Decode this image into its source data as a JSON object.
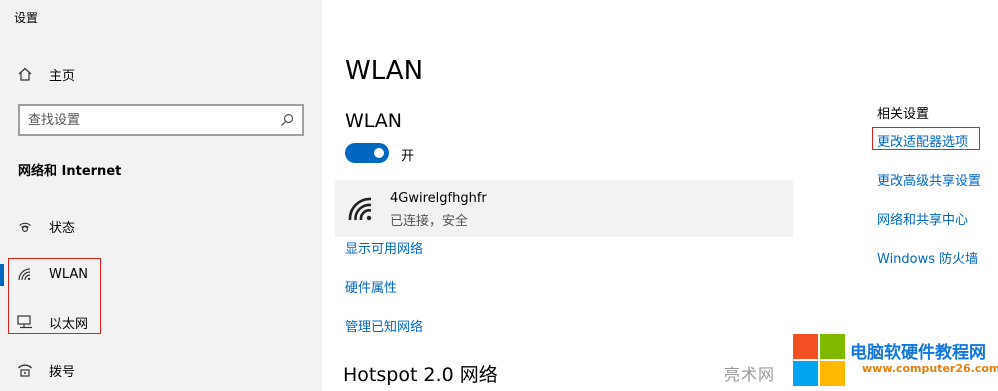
{
  "window": {
    "title": "设置"
  },
  "sidebar": {
    "home_label": "主页",
    "search_placeholder": "查找设置",
    "section_heading": "网络和 Internet",
    "items": [
      {
        "label": "状态",
        "icon": "status-icon"
      },
      {
        "label": "WLAN",
        "icon": "wifi-icon",
        "selected": true
      },
      {
        "label": "以太网",
        "icon": "ethernet-icon"
      },
      {
        "label": "拨号",
        "icon": "dialup-icon"
      }
    ]
  },
  "main": {
    "title": "WLAN",
    "section_title": "WLAN",
    "toggle": {
      "state_label": "开",
      "on": true
    },
    "network": {
      "name": "4Gwirelgfhghfr",
      "status": "已连接，安全"
    },
    "links": {
      "show_available": "显示可用网络",
      "hardware_properties": "硬件属性",
      "manage_known": "管理已知网络"
    },
    "hotspot_heading": "Hotspot 2.0 网络"
  },
  "related": {
    "title": "相关设置",
    "links": [
      "更改适配器选项",
      "更改高级共享设置",
      "网络和共享中心",
      "Windows 防火墙"
    ]
  },
  "watermark": {
    "text": "亮术网",
    "brand": "电脑软硬件教程网",
    "url": "www.computer26.com"
  },
  "colors": {
    "accent": "#0067c0",
    "highlight_box": "#e0201c",
    "sidebar_bg": "#f2f2f2"
  }
}
